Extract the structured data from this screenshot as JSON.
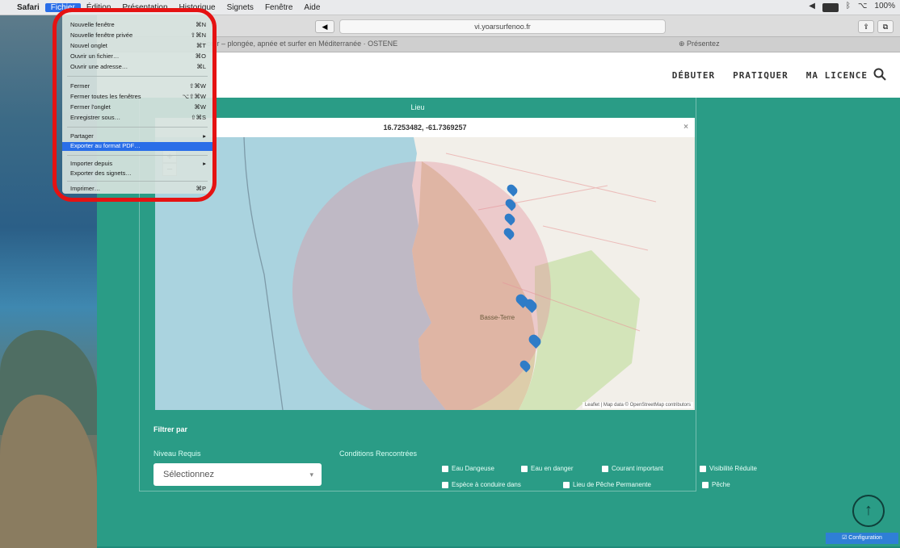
{
  "menubar": {
    "apple": "",
    "app": "Safari",
    "items": [
      "Fichier",
      "Édition",
      "Présentation",
      "Historique",
      "Signets",
      "Fenêtre",
      "Aide"
    ],
    "active_index": 0,
    "status": [
      "◀",
      "ᛒ",
      "⌥",
      "100%"
    ]
  },
  "browser": {
    "url": "vi.yoarsurfenoo.fr",
    "tab_left": "Sortir – plongée, apnée et surfer en Méditerranée · OSTENE",
    "tab_right": "⊕ Présentez"
  },
  "site": {
    "nav": [
      "DÉBUTER",
      "PRATIQUER",
      "MA LICENCE"
    ],
    "search_icon": "magnifier"
  },
  "map": {
    "section_label": "Lieu",
    "coords": "16.7253482, -61.7369257",
    "zoom_in": "+",
    "zoom_out": "−",
    "region_label": "Basse-Terre",
    "attribution": "Leaflet | Map data © OpenStreetMap contributors",
    "close_glyph": "×"
  },
  "filters": {
    "title": "Filtrer par",
    "niveau_label": "Niveau Requis",
    "select_value": "Sélectionnez",
    "conditions_label": "Conditions Rencontrées",
    "checkboxes": [
      "Eau Dangeuse",
      "Eau en danger",
      "Courant important",
      "Visibilité Réduite",
      "Espèce à conduire dans",
      "Lieu de Pêche Permanente",
      "Pêche"
    ]
  },
  "menu": {
    "rows": [
      {
        "label": "Nouvelle fenêtre",
        "shortcut": "⌘N"
      },
      {
        "label": "Nouvelle fenêtre privée",
        "shortcut": "⇧⌘N"
      },
      {
        "label": "Nouvel onglet",
        "shortcut": "⌘T"
      },
      {
        "label": "Ouvrir un fichier…",
        "shortcut": "⌘O"
      },
      {
        "label": "Ouvrir une adresse…",
        "shortcut": "⌘L"
      },
      {
        "label": "Fermer",
        "shortcut": "⇧⌘W"
      },
      {
        "label": "Fermer toutes les fenêtres",
        "shortcut": "⌥⇧⌘W"
      },
      {
        "label": "Fermer l'onglet",
        "shortcut": "⌘W"
      },
      {
        "label": "Enregistrer sous…",
        "shortcut": "⇧⌘S"
      },
      {
        "label": "Partager",
        "shortcut": "▸"
      },
      {
        "label": "Exporter au format PDF…",
        "shortcut": ""
      },
      {
        "label": "Importer depuis",
        "shortcut": "▸"
      },
      {
        "label": "Exporter des signets…",
        "shortcut": ""
      },
      {
        "label": "Imprimer…",
        "shortcut": "⌘P"
      }
    ],
    "highlighted": "Exporter au format PDF…"
  },
  "bottom": {
    "scroll_top_glyph": "↑",
    "help": "☑ Configuration"
  }
}
